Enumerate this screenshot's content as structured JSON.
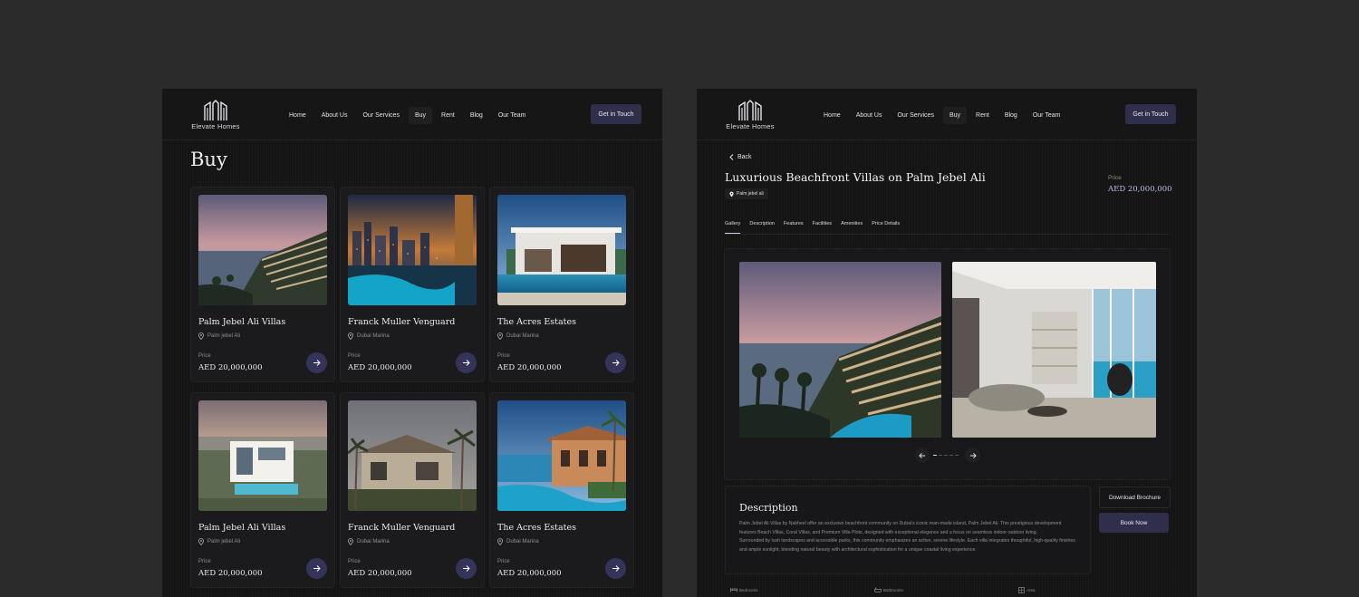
{
  "brand": {
    "name": "Elevate Homes"
  },
  "nav": {
    "items": [
      "Home",
      "About Us",
      "Our Services",
      "Buy",
      "Rent",
      "Blog",
      "Our Team"
    ],
    "active": "Buy",
    "cta": "Get in Touch"
  },
  "listing": {
    "heading": "Buy",
    "price_label": "Price",
    "cards": [
      {
        "title": "Palm Jebel Ali Villas",
        "location": "Palm jebel Ali",
        "price": "AED 20,000,000"
      },
      {
        "title": "Franck Muller Venguard",
        "location": "Dubai Marina",
        "price": "AED 20,000,000"
      },
      {
        "title": "The Acres Estates",
        "location": "Dubai Marina",
        "price": "AED 20,000,000"
      },
      {
        "title": "Palm Jebel Ali Villas",
        "location": "Palm jebel Ali",
        "price": "AED 20,000,000"
      },
      {
        "title": "Franck Muller Venguard",
        "location": "Dubai Marina",
        "price": "AED 20,000,000"
      },
      {
        "title": "The Acres Estates",
        "location": "Dubai Marina",
        "price": "AED 20,000,000"
      }
    ]
  },
  "detail": {
    "back": "Back",
    "title": "Luxurious Beachfront Villas on Palm Jebel Ali",
    "location": "Palm jebel ali",
    "price_label": "Price",
    "price": "AED 20,000,000",
    "tabs": [
      "Gallery",
      "Description",
      "Features",
      "Facilities",
      "Amenities",
      "Price Details"
    ],
    "active_tab": "Gallery",
    "gallery": {
      "slide_count": 5,
      "current_slide": 1
    },
    "description": {
      "heading": "Description",
      "p1": "Palm Jebel Ali Villas by Nakheel offer an exclusive beachfront community on Dubai’s iconic man-made island, Palm Jebel Ali. This prestigious development features Beach Villas, Coral Villas, and Premium Villa Plots, designed with exceptional elegance and a focus on seamless indoor-outdoor living.",
      "p2": "Surrounded by lush landscapes and accessible parks, this community emphasizes an active, serene lifestyle. Each villa integrates thoughtful, high-quality finishes and ample sunlight, blending natural beauty with architectural sophistication for a unique coastal living experience."
    },
    "download_button": "Download Brochure",
    "book_button": "Book Now",
    "specs": [
      "Bedrooms",
      "Bathrooms",
      "Area"
    ]
  },
  "colors": {
    "background": "#2b2b2b",
    "panel": "#141414",
    "accent": "#2f2f4c",
    "arrow_button": "#34345a",
    "price_highlight": "#b9bde6"
  }
}
